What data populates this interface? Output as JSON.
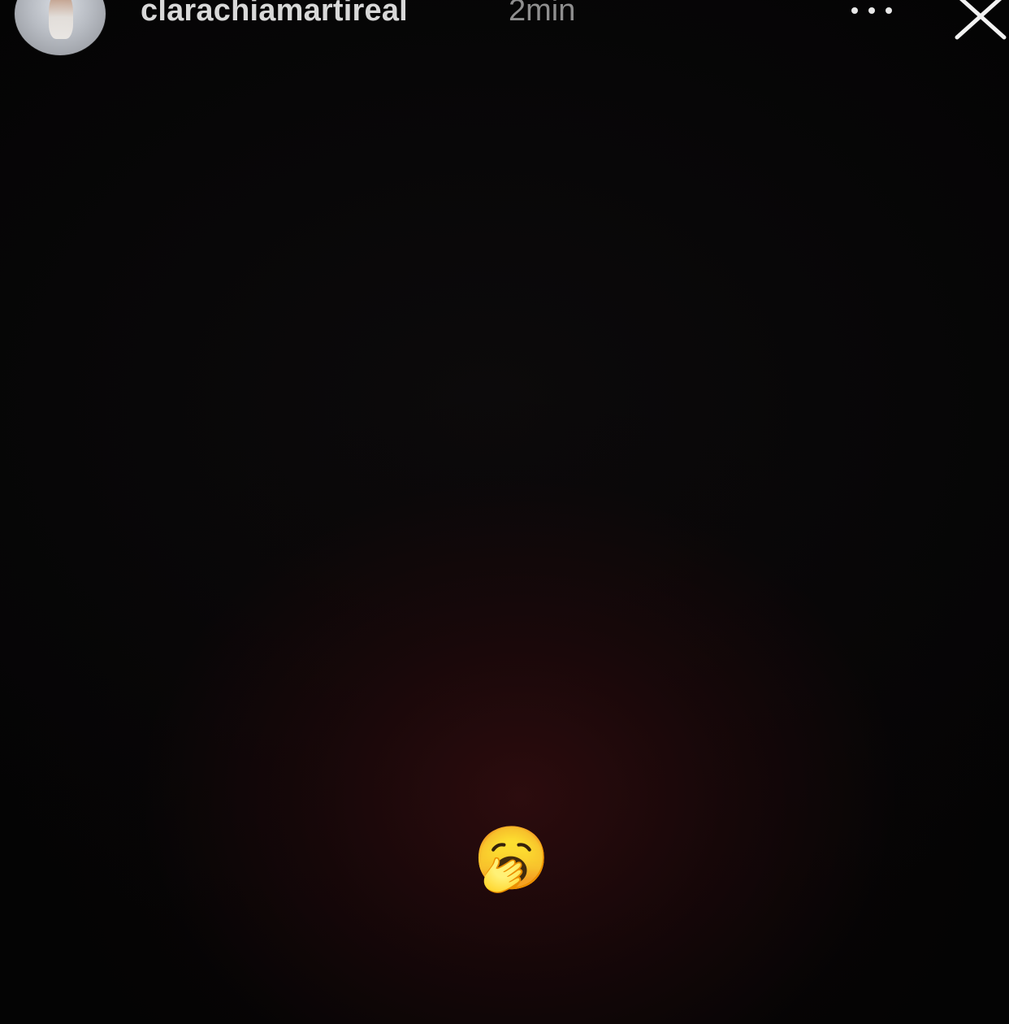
{
  "story": {
    "username": "clarachiamartireal",
    "time": "2min",
    "sticker_emoji": "🥱"
  },
  "icons": {
    "avatar": "profile-avatar",
    "more": "more-icon",
    "close": "close-icon",
    "sticker": "yawning-face-emoji"
  },
  "colors": {
    "username": "#d8d8d8",
    "time": "#8f8f8f",
    "background": "#050405"
  }
}
